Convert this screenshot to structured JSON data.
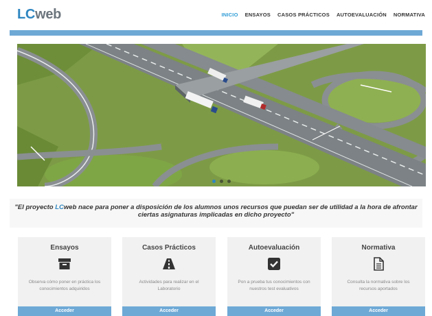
{
  "header": {
    "logo_prefix": "LC",
    "logo_suffix": "web",
    "nav": [
      {
        "label": "INICIO",
        "active": true
      },
      {
        "label": "ENSAYOS",
        "active": false
      },
      {
        "label": "CASOS PRÁCTICOS",
        "active": false
      },
      {
        "label": "AUTOEVALUACIÓN",
        "active": false
      },
      {
        "label": "NORMATIVA",
        "active": false
      }
    ],
    "accent_color": "#2e86c1",
    "bar_color": "#6ea9d6"
  },
  "hero": {
    "image": "highway-interchange-aerial-photo",
    "slides": 3,
    "active_slide": 1
  },
  "quote": {
    "open": "\"El proyecto ",
    "brand_lc": "LC",
    "brand_web": "web",
    "rest": " nace para poner a disposición de los alumnos unos recursos que puedan ser de utilidad a la hora de afrontar ciertas asignaturas implicadas en dicho proyecto\""
  },
  "cards": [
    {
      "title": "Ensayos",
      "icon": "archive-box-icon",
      "desc": "Observa cómo poner en práctica los conocimientos adquiridos",
      "button": "Acceder"
    },
    {
      "title": "Casos Prácticos",
      "icon": "road-icon",
      "desc": "Actividades para realizar en el Laboratorio",
      "button": "Acceder"
    },
    {
      "title": "Autoevaluación",
      "icon": "check-square-icon",
      "desc": "Pon a prueba tus conocimientos con nuestros test evaluativos",
      "button": "Acceder"
    },
    {
      "title": "Normativa",
      "icon": "document-icon",
      "desc": "Consulta la normativa sobre los recursos aportados",
      "button": "Acceder"
    }
  ]
}
